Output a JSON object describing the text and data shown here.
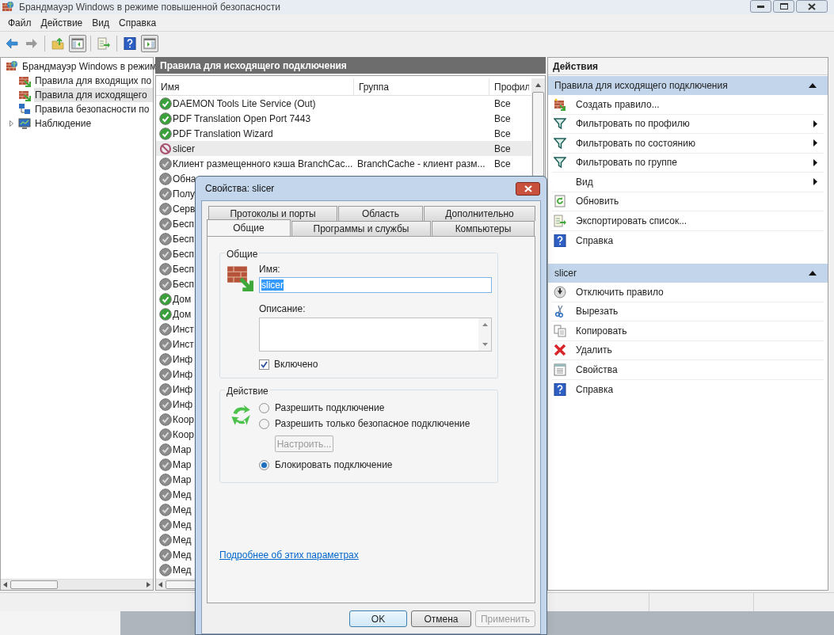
{
  "window": {
    "title": "Брандмауэр Windows в режиме повышенной безопасности"
  },
  "menu": [
    "Файл",
    "Действие",
    "Вид",
    "Справка"
  ],
  "tree": [
    {
      "label": "Брандмауэр Windows в режим",
      "kind": "firewall",
      "selected": false,
      "children": [
        {
          "label": "Правила для входящих по",
          "kind": "inbound",
          "selected": false
        },
        {
          "label": "Правила для исходящего",
          "kind": "outbound",
          "selected": true
        },
        {
          "label": "Правила безопасности по",
          "kind": "security",
          "selected": false
        },
        {
          "label": "Наблюдение",
          "kind": "monitoring",
          "selected": false,
          "expanded": false
        }
      ]
    }
  ],
  "rules": {
    "title": "Правила для исходящего подключения",
    "columns": [
      "Имя",
      "Группа",
      "Профил"
    ],
    "rows": [
      {
        "name": "DAEMON Tools Lite Service (Out)",
        "profile": "Все",
        "kind": "allow",
        "selected": false
      },
      {
        "name": "PDF Translation Open Port 7443",
        "profile": "Все",
        "kind": "allow",
        "selected": false
      },
      {
        "name": "PDF Translation Wizard",
        "profile": "Все",
        "kind": "allow",
        "selected": false
      },
      {
        "name": "slicer",
        "profile": "Все",
        "kind": "block",
        "selected": true
      },
      {
        "name": "Клиент размещенного кэша BranchCac...",
        "group": "BranchCache - клиент разм...",
        "profile": "Все",
        "kind": "off",
        "selected": false
      },
      {
        "name": "Обна",
        "kind": "off",
        "selected": false
      },
      {
        "name": "Полу",
        "kind": "off",
        "selected": false
      },
      {
        "name": "Серв",
        "kind": "off",
        "selected": false
      },
      {
        "name": "Бесп",
        "kind": "off",
        "selected": false
      },
      {
        "name": "Бесп",
        "kind": "off",
        "selected": false
      },
      {
        "name": "Бесп",
        "kind": "off",
        "selected": false
      },
      {
        "name": "Бесп",
        "kind": "off",
        "selected": false
      },
      {
        "name": "Бесп",
        "kind": "off",
        "selected": false
      },
      {
        "name": "Дом",
        "kind": "allow",
        "selected": false
      },
      {
        "name": "Дом",
        "kind": "allow",
        "selected": false
      },
      {
        "name": "Инст",
        "kind": "off",
        "selected": false
      },
      {
        "name": "Инст",
        "kind": "off",
        "selected": false
      },
      {
        "name": "Инф",
        "kind": "off",
        "selected": false
      },
      {
        "name": "Инф",
        "kind": "off",
        "selected": false
      },
      {
        "name": "Инф",
        "kind": "off",
        "selected": false
      },
      {
        "name": "Инф",
        "kind": "off",
        "selected": false
      },
      {
        "name": "Коор",
        "kind": "off",
        "selected": false
      },
      {
        "name": "Коор",
        "kind": "off",
        "selected": false
      },
      {
        "name": "Мар",
        "kind": "off",
        "selected": false
      },
      {
        "name": "Мар",
        "kind": "off",
        "selected": false
      },
      {
        "name": "Мар",
        "kind": "off",
        "selected": false
      },
      {
        "name": "Мед",
        "kind": "off",
        "selected": false
      },
      {
        "name": "Мед",
        "kind": "off",
        "selected": false
      },
      {
        "name": "Мед",
        "kind": "off",
        "selected": false
      },
      {
        "name": "Мед",
        "kind": "off",
        "selected": false
      },
      {
        "name": "Мед",
        "kind": "off",
        "selected": false
      },
      {
        "name": "Мед",
        "kind": "off",
        "selected": false
      }
    ]
  },
  "actions": {
    "title": "Действия",
    "sections": [
      {
        "title": "Правила для исходящего подключения",
        "expanded": true,
        "items": [
          {
            "label": "Создать правило...",
            "kind": "new-rule",
            "submenu": false
          },
          {
            "label": "Фильтровать по профилю",
            "kind": "filter",
            "submenu": true
          },
          {
            "label": "Фильтровать по состоянию",
            "kind": "filter",
            "submenu": true
          },
          {
            "label": "Фильтровать по группе",
            "kind": "filter",
            "submenu": true
          },
          {
            "label": "Вид",
            "kind": "none",
            "submenu": true
          },
          {
            "label": "Обновить",
            "kind": "refresh",
            "submenu": false
          },
          {
            "label": "Экспортировать список...",
            "kind": "export",
            "submenu": false
          },
          {
            "label": "Справка",
            "kind": "help",
            "submenu": false
          }
        ]
      },
      {
        "title": "slicer",
        "expanded": true,
        "items": [
          {
            "label": "Отключить правило",
            "kind": "disable",
            "submenu": false
          },
          {
            "label": "Вырезать",
            "kind": "cut",
            "submenu": false
          },
          {
            "label": "Копировать",
            "kind": "copy",
            "submenu": false
          },
          {
            "label": "Удалить",
            "kind": "delete",
            "submenu": false
          },
          {
            "label": "Свойства",
            "kind": "properties",
            "submenu": false
          },
          {
            "label": "Справка",
            "kind": "help",
            "submenu": false
          }
        ]
      }
    ]
  },
  "dialog": {
    "title": "Свойства: slicer",
    "tab_rows": [
      [
        {
          "label": "Протоколы и порты",
          "selected": false
        },
        {
          "label": "Область",
          "selected": false
        },
        {
          "label": "Дополнительно",
          "selected": false
        }
      ],
      [
        {
          "label": "Общие",
          "selected": true
        },
        {
          "label": "Программы и службы",
          "selected": false
        },
        {
          "label": "Компьютеры",
          "selected": false
        }
      ]
    ],
    "general": {
      "legend": "Общие",
      "name_label": "Имя:",
      "name_value": "slicer",
      "description_label": "Описание:",
      "enabled": {
        "label": "Включено",
        "checked": true
      }
    },
    "action": {
      "legend": "Действие",
      "options": [
        {
          "label": "Разрешить подключение",
          "selected": false
        },
        {
          "label": "Разрешить только безопасное подключение",
          "selected": false
        },
        {
          "label": "Блокировать подключение",
          "selected": true
        }
      ],
      "customize": {
        "label": "Настроить...",
        "disabled": true
      }
    },
    "link": "Подробнее об этих параметрах",
    "buttons": [
      {
        "label": "OK",
        "default": true,
        "disabled": false
      },
      {
        "label": "Отмена",
        "default": false,
        "disabled": false
      },
      {
        "label": "Применить",
        "default": false,
        "disabled": true
      }
    ]
  }
}
